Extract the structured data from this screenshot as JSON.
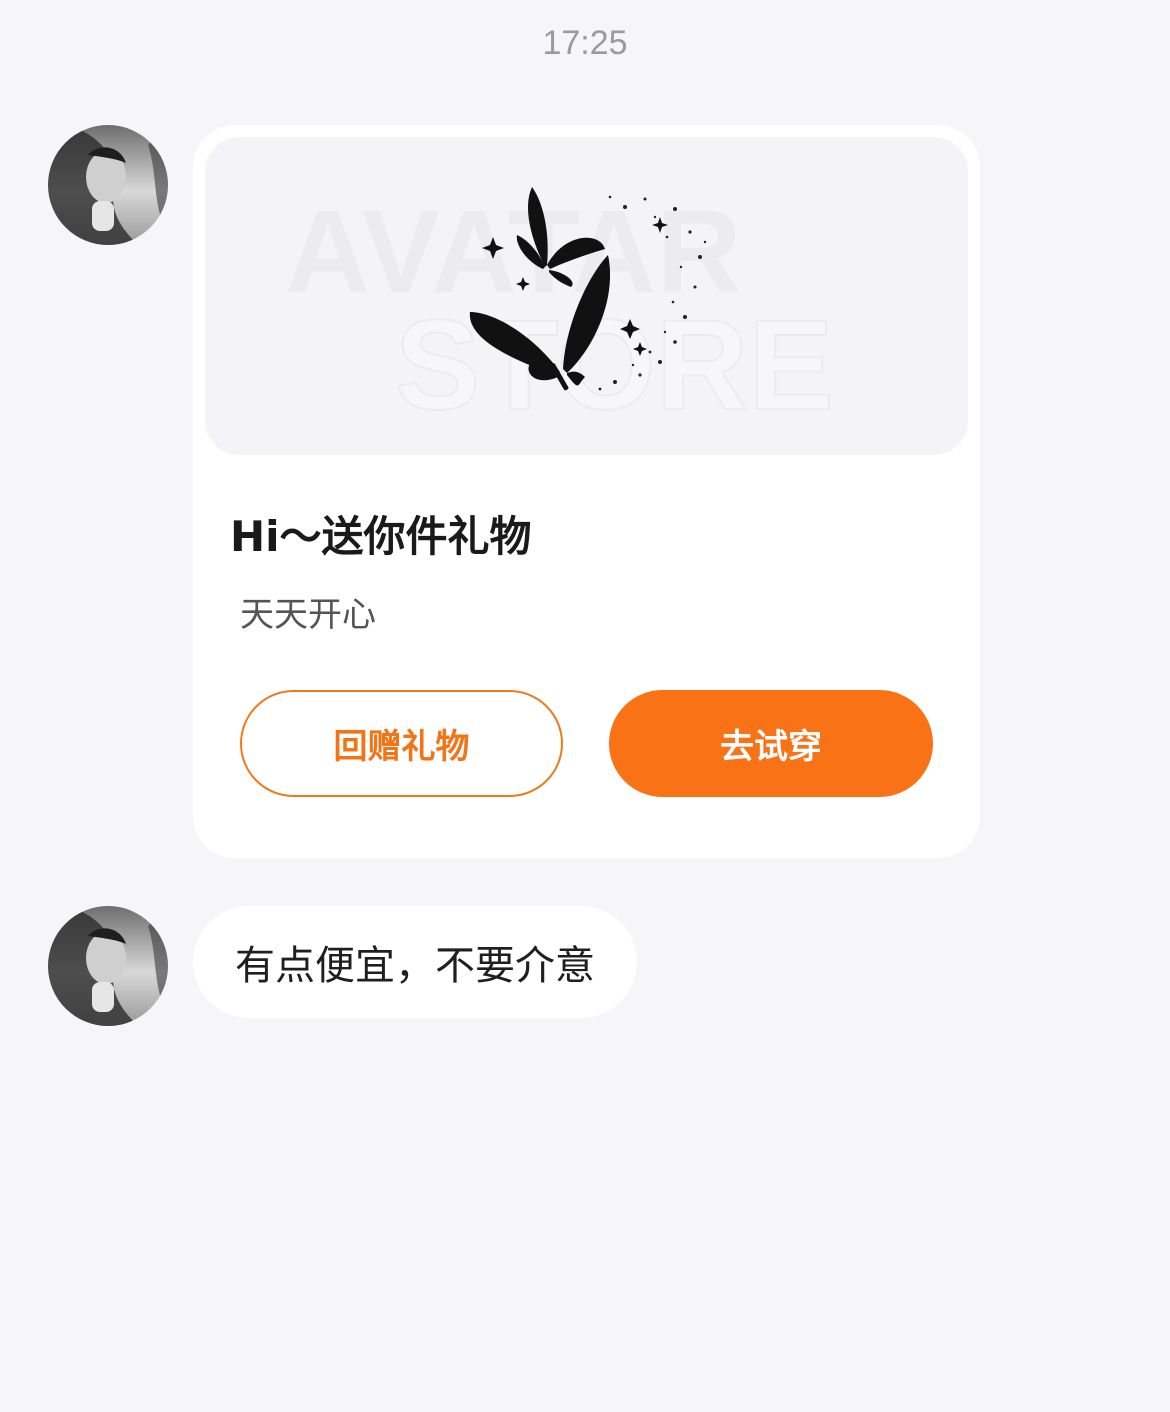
{
  "chat": {
    "timestamp": "17:25",
    "messages": [
      {
        "type": "gift-card",
        "sender_avatar": "person-avatar",
        "image": {
          "watermark_line1": "AVATAR",
          "watermark_line2": "STORE",
          "icon": "butterflies-icon"
        },
        "title": "Hi～送你件礼物",
        "message": "天天开心",
        "buttons": {
          "return_gift": "回赠礼物",
          "try_on": "去试穿"
        }
      },
      {
        "type": "text",
        "sender_avatar": "person-avatar",
        "text": "有点便宜，不要介意"
      }
    ]
  },
  "colors": {
    "background": "#f6f5f8",
    "accent": "#f97316",
    "card": "#ffffff"
  }
}
